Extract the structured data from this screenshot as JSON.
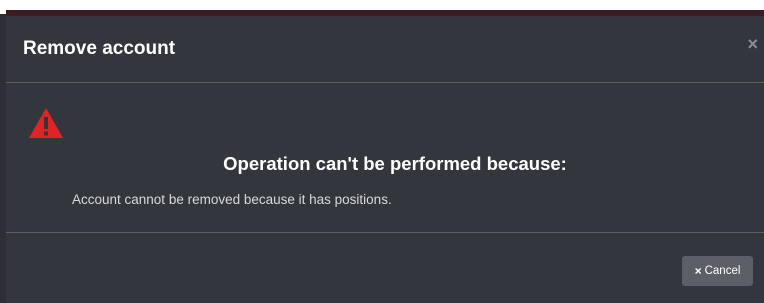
{
  "dialog": {
    "title": "Remove account",
    "close_glyph": "×",
    "warning_icon": "warning-triangle-icon",
    "headline": "Operation can't be performed because:",
    "message": "Account cannot be removed because it has positions.",
    "cancel_label": "Cancel",
    "cancel_icon_glyph": "×"
  },
  "colors": {
    "background": "#33363c",
    "accent_warning": "#e02424",
    "button": "#5c5f66",
    "title_text": "#ffffff"
  }
}
